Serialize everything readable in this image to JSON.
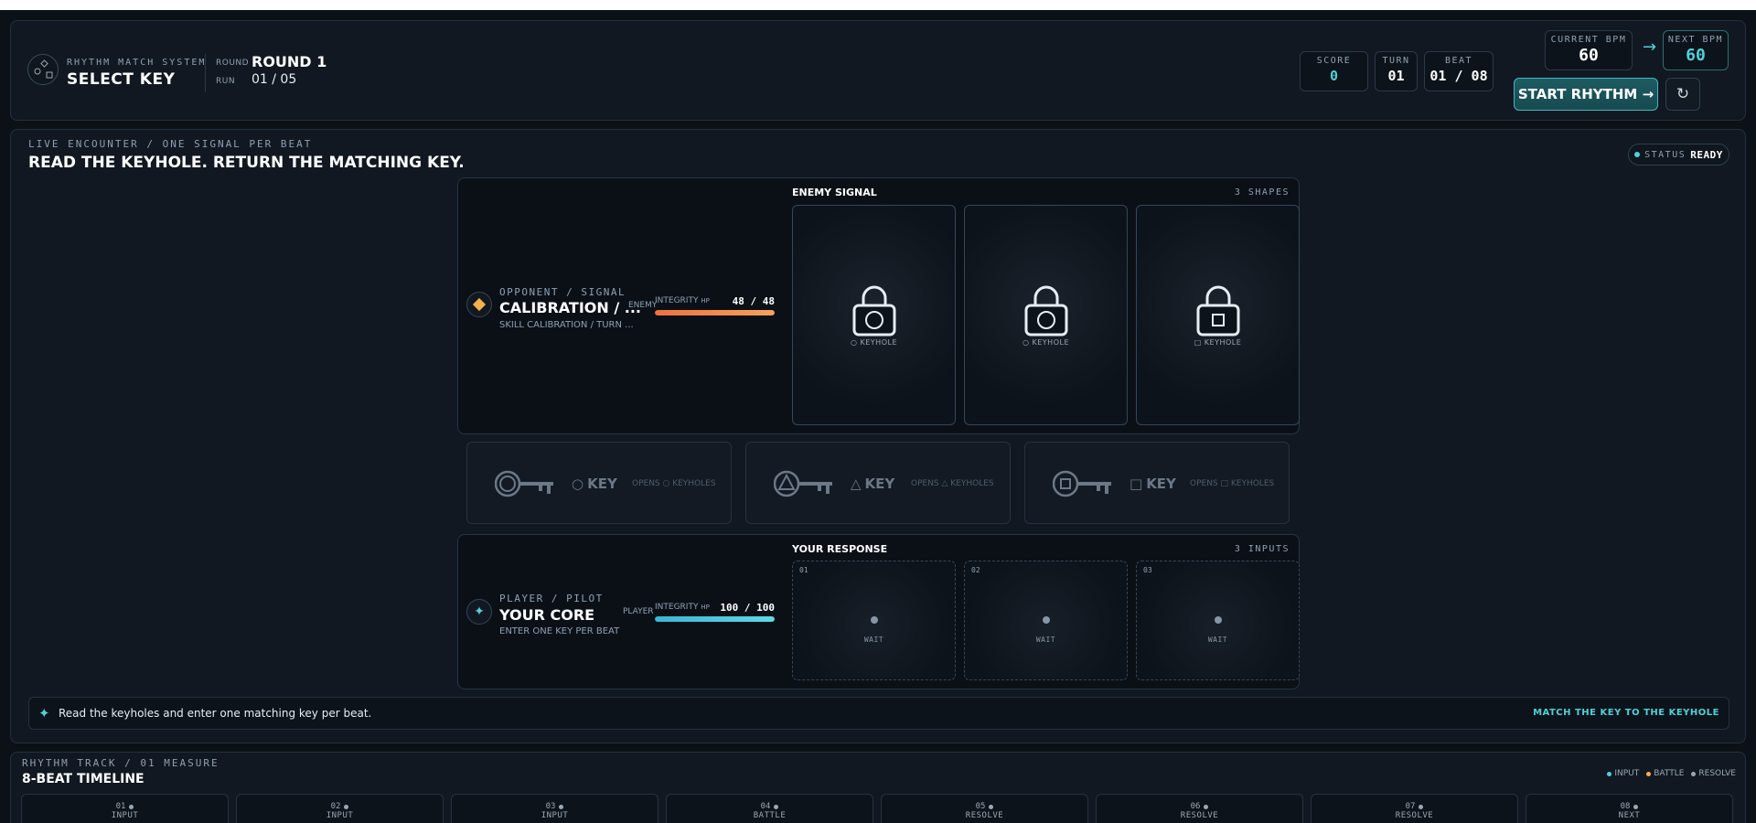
{
  "header": {
    "system_label": "RHYTHM MATCH SYSTEM",
    "title": "SELECT KEY",
    "round_label": "ROUND",
    "round_value": "ROUND 1",
    "run_label": "RUN",
    "run_value": "01 / 05",
    "score_label": "SCORE",
    "score_value": "0",
    "turn_label": "TURN",
    "turn_value": "01",
    "beat_label": "BEAT",
    "beat_value": "01 / 08",
    "current_bpm_label": "CURRENT BPM",
    "current_bpm_value": "60",
    "next_bpm_label": "NEXT BPM",
    "next_bpm_value": "60",
    "bpm_arrow": "→",
    "start_label": "START RHYTHM →",
    "reset_icon": "↻"
  },
  "encounter": {
    "eyebrow": "LIVE ENCOUNTER / ONE SIGNAL PER BEAT",
    "title": "READ THE KEYHOLE. RETURN THE MATCHING KEY.",
    "status_label": "STATUS",
    "status_value": "READY",
    "enemy": {
      "eyebrow": "OPPONENT / SIGNAL",
      "name": "CALIBRATION / ...",
      "sub": "SKILL CALIBRATION / TURN ...",
      "side": "ENEMY",
      "hp_label": "INTEGRITY",
      "hp_unit": "HP",
      "hp_text": "48 / 48",
      "hp_fraction": 1.0,
      "section_title": "ENEMY SIGNAL",
      "section_count": "3 SHAPES",
      "signals": [
        {
          "shape": "circle",
          "caption": "○ KEYHOLE"
        },
        {
          "shape": "circle",
          "caption": "○ KEYHOLE"
        },
        {
          "shape": "square",
          "caption": "□ KEYHOLE"
        }
      ]
    },
    "keys": [
      {
        "shape": "circle",
        "glyph": "○",
        "label": "KEY",
        "hint": "OPENS ○ KEYHOLES"
      },
      {
        "shape": "triangle",
        "glyph": "△",
        "label": "KEY",
        "hint": "OPENS △ KEYHOLES"
      },
      {
        "shape": "square",
        "glyph": "□",
        "label": "KEY",
        "hint": "OPENS □ KEYHOLES"
      }
    ],
    "player": {
      "eyebrow": "PLAYER / PILOT",
      "name": "YOUR CORE",
      "sub": "ENTER ONE KEY PER BEAT",
      "side": "PLAYER",
      "hp_label": "INTEGRITY",
      "hp_unit": "HP",
      "hp_text": "100 / 100",
      "hp_fraction": 1.0,
      "section_title": "YOUR RESPONSE",
      "section_count": "3 INPUTS",
      "inputs": [
        {
          "num": "01",
          "state": "WAIT"
        },
        {
          "num": "02",
          "state": "WAIT"
        },
        {
          "num": "03",
          "state": "WAIT"
        }
      ]
    },
    "hint": {
      "icon": "✦",
      "text": "Read the keyholes and enter one matching key per beat.",
      "right": "MATCH THE KEY TO THE KEYHOLE"
    }
  },
  "track": {
    "eyebrow": "RHYTHM TRACK / 01 MEASURE",
    "title": "8-BEAT TIMELINE",
    "legend": [
      {
        "label": "INPUT",
        "color": "#4fd1d9"
      },
      {
        "label": "BATTLE",
        "color": "#f5b04a"
      },
      {
        "label": "RESOLVE",
        "color": "#9aa8b6"
      }
    ],
    "beats": [
      {
        "num": "01",
        "phase": "INPUT"
      },
      {
        "num": "02",
        "phase": "INPUT"
      },
      {
        "num": "03",
        "phase": "INPUT"
      },
      {
        "num": "04",
        "phase": "BATTLE"
      },
      {
        "num": "05",
        "phase": "RESOLVE"
      },
      {
        "num": "06",
        "phase": "RESOLVE"
      },
      {
        "num": "07",
        "phase": "RESOLVE"
      },
      {
        "num": "08",
        "phase": "NEXT"
      }
    ]
  },
  "colors": {
    "accent": "#4fd1d9",
    "enemy_hp": "#f08a4b",
    "player_hp": "#4fc3dc",
    "enemy_icon": "#f5b04a"
  }
}
